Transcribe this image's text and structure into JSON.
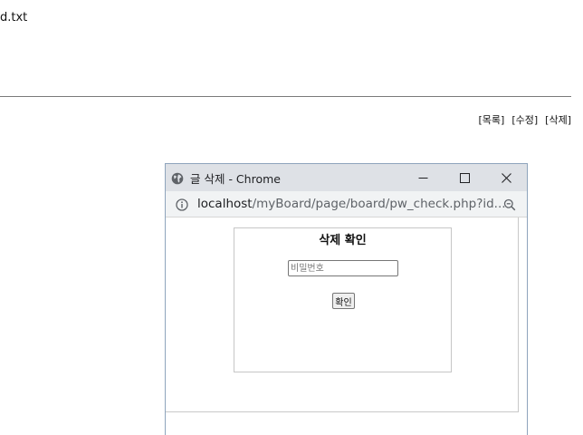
{
  "background_page": {
    "filename_fragment": "d.txt",
    "links": [
      "[목록]",
      "[수정]",
      "[삭제]"
    ]
  },
  "popup": {
    "title": "글 삭제 - Chrome",
    "url_host": "localhost",
    "url_path": "/myBoard/page/board/pw_check.php?id...",
    "form": {
      "heading": "삭제 확인",
      "password_placeholder": "비밀번호",
      "password_value": "",
      "confirm_label": "확인"
    }
  },
  "colors": {
    "titlebar": "#dee1e6",
    "addressbar": "#f1f3f4",
    "window_border": "#8ea4bc"
  },
  "icons": [
    "globe-icon",
    "minimize-icon",
    "maximize-icon",
    "close-icon",
    "info-icon",
    "zoom-out-icon"
  ]
}
